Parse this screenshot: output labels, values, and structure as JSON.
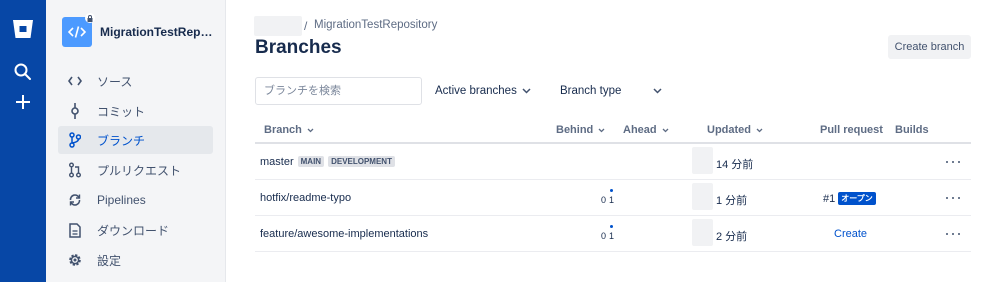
{
  "sidebar": {
    "repo_name": "MigrationTestReposit...",
    "items": [
      {
        "label": "ソース",
        "icon": "code-icon"
      },
      {
        "label": "コミット",
        "icon": "commit-icon"
      },
      {
        "label": "ブランチ",
        "icon": "branch-icon",
        "active": true
      },
      {
        "label": "プルリクエスト",
        "icon": "pull-request-icon"
      },
      {
        "label": "Pipelines",
        "icon": "pipelines-icon"
      },
      {
        "label": "ダウンロード",
        "icon": "download-icon"
      },
      {
        "label": "設定",
        "icon": "gear-icon"
      }
    ]
  },
  "breadcrumb": {
    "separator": "/",
    "repo": "MigrationTestRepository"
  },
  "page_title": "Branches",
  "create_branch_label": "Create branch",
  "filters": {
    "search_placeholder": "ブランチを検索",
    "branch_filter": "Active branches",
    "branch_type": "Branch type"
  },
  "table": {
    "headers": {
      "branch": "Branch",
      "behind": "Behind",
      "ahead": "Ahead",
      "updated": "Updated",
      "pull_request": "Pull request",
      "builds": "Builds"
    },
    "rows": [
      {
        "name": "master",
        "lozenges": [
          "MAIN",
          "DEVELOPMENT"
        ],
        "behind": "",
        "ahead": "",
        "updated": "14 分前",
        "pr": "",
        "pr_status": "",
        "pr_action": ""
      },
      {
        "name": "hotfix/readme-typo",
        "lozenges": [],
        "behind": "0",
        "ahead": "1",
        "updated": "1 分前",
        "pr": "#1",
        "pr_status": "オープン",
        "pr_action": ""
      },
      {
        "name": "feature/awesome-implementations",
        "lozenges": [],
        "behind": "0",
        "ahead": "1",
        "updated": "2 分前",
        "pr": "",
        "pr_status": "",
        "pr_action": "Create"
      }
    ]
  },
  "colors": {
    "global_nav": "#0747a6",
    "accent": "#0052cc",
    "sidebar_bg": "#f4f5f7"
  }
}
